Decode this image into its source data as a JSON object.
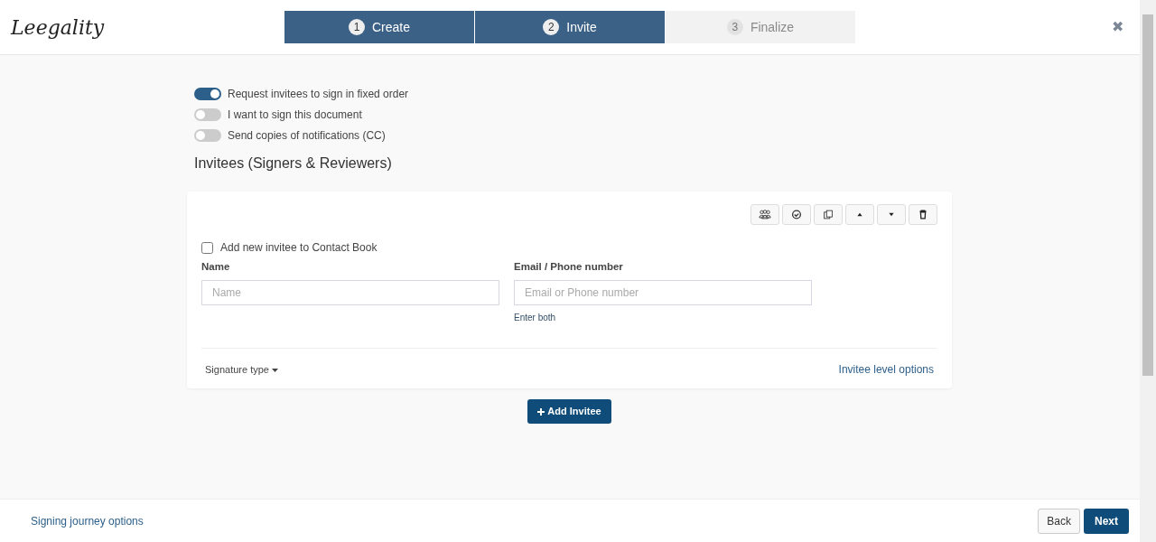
{
  "logo": {
    "text": "Leegality"
  },
  "steps": [
    {
      "number": "1",
      "label": "Create",
      "disabled": false
    },
    {
      "number": "2",
      "label": "Invite",
      "disabled": false
    },
    {
      "number": "3",
      "label": "Finalize",
      "disabled": true
    }
  ],
  "close": {
    "glyph": "✖"
  },
  "toggles": [
    {
      "label": "Request invitees to sign in fixed order",
      "on": true
    },
    {
      "label": "I want to sign this document",
      "on": false
    },
    {
      "label": "Send copies of notifications (CC)",
      "on": false
    }
  ],
  "section_title": "Invitees (Signers & Reviewers)",
  "invitee": {
    "toolbar": [
      {
        "kind": "group"
      },
      {
        "kind": "check"
      },
      {
        "kind": "copy"
      },
      {
        "kind": "up"
      },
      {
        "kind": "down"
      },
      {
        "kind": "trash"
      }
    ],
    "contact_book": {
      "label": "Add new invitee to Contact Book",
      "checked": false
    },
    "name": {
      "label": "Name",
      "placeholder": "Name"
    },
    "email": {
      "label": "Email / Phone number",
      "placeholder": "Email or Phone number",
      "hint": "Enter both"
    },
    "signature_type": "Signature type",
    "options_link": "Invitee level options"
  },
  "add_button": "Add Invitee",
  "footer": {
    "link": "Signing journey options",
    "back": "Back",
    "next": "Next"
  }
}
